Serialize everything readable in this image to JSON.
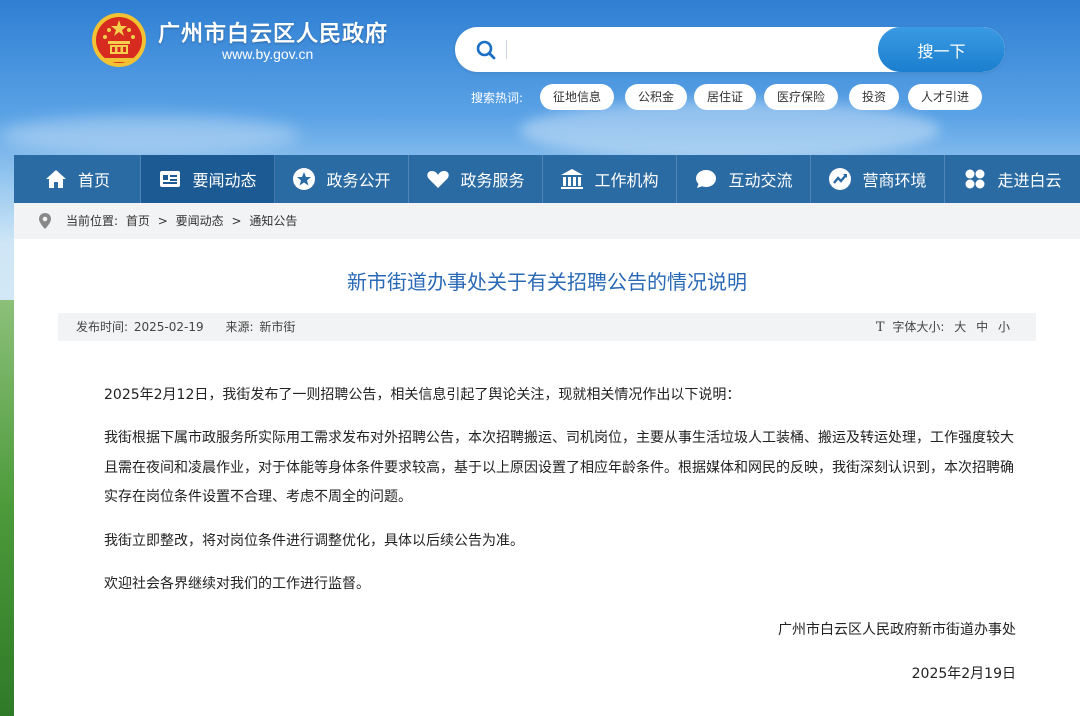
{
  "header": {
    "site_title": "广州市白云区人民政府",
    "site_domain": "www.by.gov.cn",
    "search": {
      "placeholder": "",
      "button_label": "搜一下"
    },
    "hot_label": "搜索热词:",
    "hot_tags": [
      "征地信息",
      "公积金",
      "居住证",
      "医疗保险",
      "投资",
      "人才引进"
    ]
  },
  "nav": {
    "items": [
      {
        "label": "首页",
        "icon": "home-icon"
      },
      {
        "label": "要闻动态",
        "icon": "news-icon",
        "active": true
      },
      {
        "label": "政务公开",
        "icon": "star-icon"
      },
      {
        "label": "政务服务",
        "icon": "heart-icon"
      },
      {
        "label": "工作机构",
        "icon": "building-icon"
      },
      {
        "label": "互动交流",
        "icon": "chat-icon"
      },
      {
        "label": "营商环境",
        "icon": "trend-icon"
      },
      {
        "label": "走进白云",
        "icon": "grid-icon"
      }
    ]
  },
  "breadcrumb": {
    "prefix": "当前位置:",
    "items": [
      "首页",
      "要闻动态",
      "通知公告"
    ],
    "separator": ">"
  },
  "article": {
    "title": "新市街道办事处关于有关招聘公告的情况说明",
    "meta": {
      "date_label": "发布时间:",
      "date": "2025-02-19",
      "source_label": "来源:",
      "source": "新市街",
      "font_size_label": "字体大小:",
      "font_sizes": [
        "大",
        "中",
        "小"
      ]
    },
    "paragraphs": [
      "2025年2月12日，我街发布了一则招聘公告，相关信息引起了舆论关注，现就相关情况作出以下说明：",
      "我街根据下属市政服务所实际用工需求发布对外招聘公告，本次招聘搬运、司机岗位，主要从事生活垃圾人工装桶、搬运及转运处理，工作强度较大且需在夜间和凌晨作业，对于体能等身体条件要求较高，基于以上原因设置了相应年龄条件。根据媒体和网民的反映，我街深刻认识到，本次招聘确实存在岗位条件设置不合理、考虑不周全的问题。",
      "我街立即整改，将对岗位条件进行调整优化，具体以后续公告为准。",
      "欢迎社会各界继续对我们的工作进行监督。"
    ],
    "signature": "广州市白云区人民政府新市街道办事处",
    "sign_date": "2025年2月19日"
  },
  "colors": {
    "nav_bg": "#2b6ba3",
    "nav_active": "#1b5a92",
    "title_blue": "#2a69b5",
    "search_button": "#1b7fcf"
  }
}
